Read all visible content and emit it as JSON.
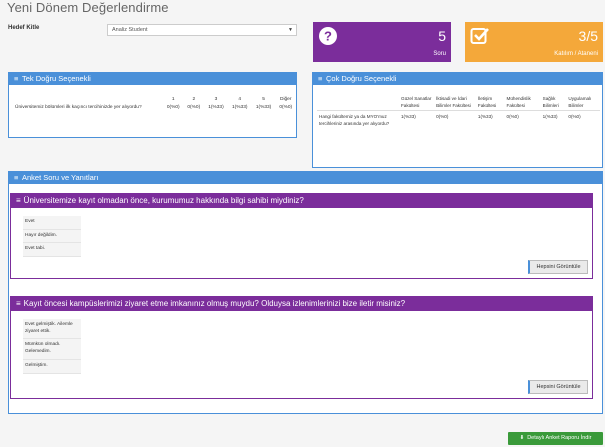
{
  "page": {
    "title": "Yeni Dönem Değerlendirme"
  },
  "filter": {
    "label": "Hedef Kitle",
    "value": "Analiz Student"
  },
  "cards": {
    "questions": {
      "value": "5",
      "label": "Soru",
      "color": "#7b2d9b",
      "icon": "question-circle-icon"
    },
    "participation": {
      "value": "3/5",
      "label": "Katılım / Ataneni",
      "color": "#f4a83a",
      "icon": "check-square-icon"
    }
  },
  "tek": {
    "title": "Tek Doğru Seçenekli",
    "columns": [
      "1",
      "2",
      "3",
      "4",
      "5",
      "Diğer"
    ],
    "rows": [
      {
        "question": "Üniversitemiz bölümleri ilk kaçıncı tercihinizde yer alıyordu?",
        "values": [
          "0(%0)",
          "0(%0)",
          "1(%33)",
          "1(%33)",
          "1(%33)",
          "0(%0)"
        ]
      }
    ]
  },
  "cok": {
    "title": "Çok Doğru Seçenekli",
    "columns": [
      "Güzel Sanatlar Fakültesi",
      "İktisadi ve İdari Bilimler Fakültesi",
      "İletişim Fakültesi",
      "Mühendislik Fakültesi",
      "Sağlık Bilimleri",
      "Uygulamalı Bilimler"
    ],
    "rows": [
      {
        "question": "Hangi fakültemiz ya da MYO'muz tercihleriniz arasında yer alıyordu?",
        "values": [
          "1(%33)",
          "0(%0)",
          "1(%33)",
          "0(%0)",
          "1(%33)",
          "0(%0)"
        ]
      }
    ]
  },
  "anket": {
    "title": "Anket Soru ve Yanıtları",
    "questions": [
      {
        "text": "Üniversitemize kayıt olmadan önce, kurumumuz hakkında bilgi sahibi miydiniz?",
        "answers": [
          "Evet",
          "Hayır değildim.",
          "Evet tabi."
        ],
        "button": "Hepsini Görüntüle"
      },
      {
        "text": "Kayıt öncesi kampüslerimizi ziyaret etme imkanınız olmuş muydu? Olduysa izlenimlerinizi bize iletir misiniz?",
        "answers": [
          "Evet gelmiştik. Ailemle ziyaret ettik.",
          "Mümkün olmadı. Gelemedim.",
          "Gelmiştim."
        ],
        "button": "Hepsini Görüntüle"
      }
    ]
  },
  "download": {
    "label": "Detaylı Anket Raporu İndir",
    "color": "#3a9a3a"
  }
}
